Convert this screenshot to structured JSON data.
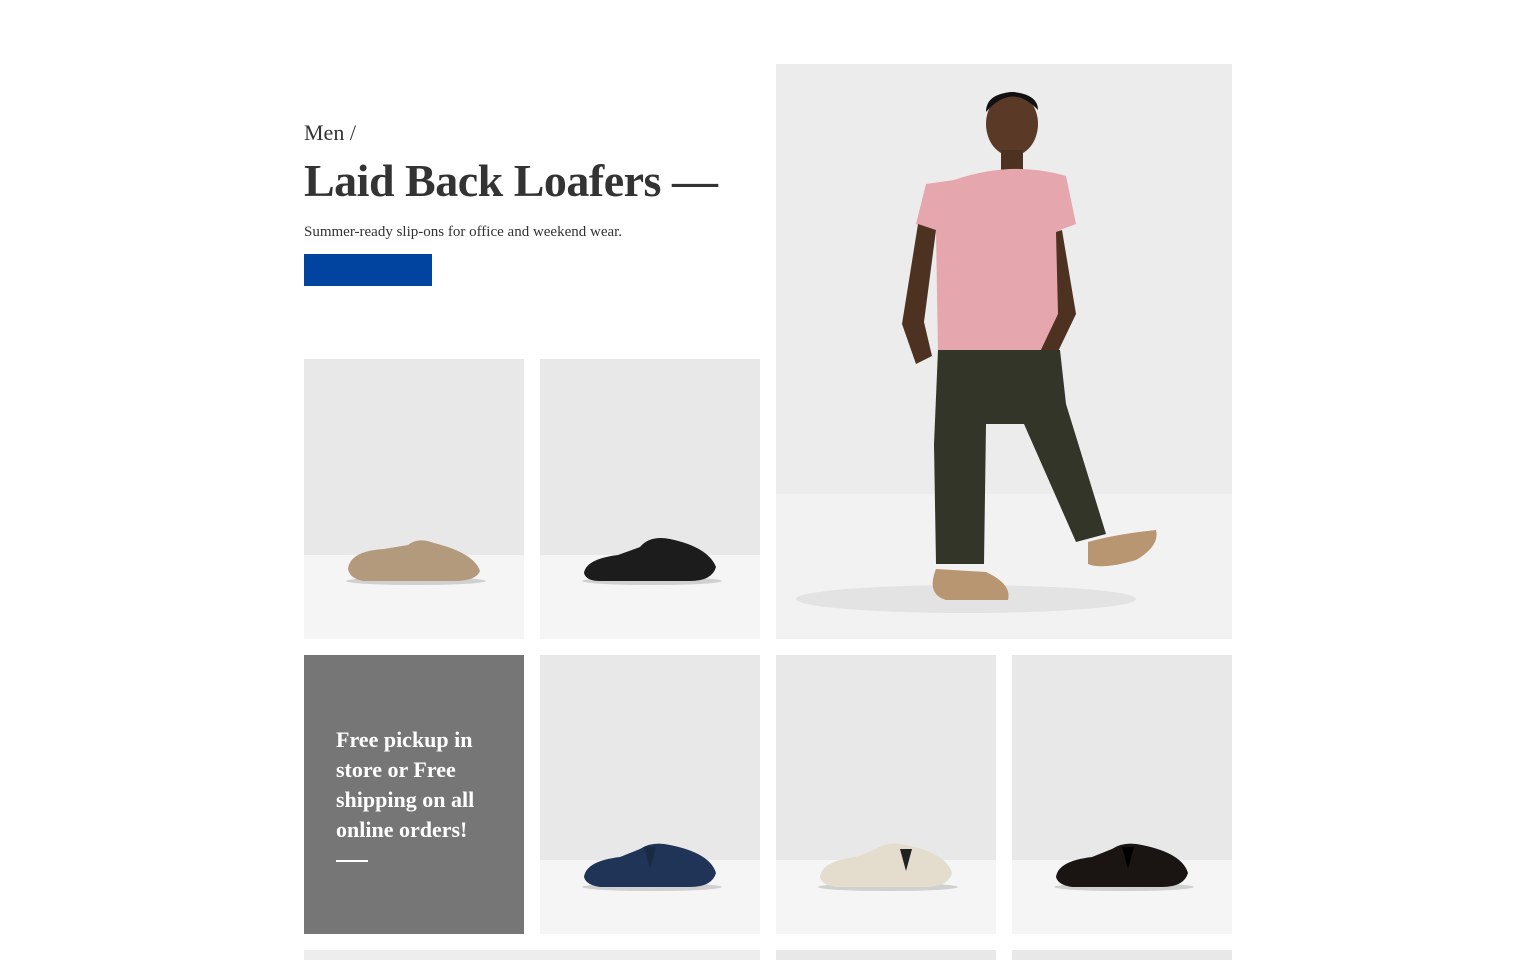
{
  "hero": {
    "breadcrumb": "Men /",
    "title": "Laid Back Loafers —",
    "subtitle": "Summer-ready slip-ons for office and weekend wear.",
    "shop_button_label": ""
  },
  "promo": {
    "text": "Free pickup in store or Free shipping on all online orders!"
  },
  "products": [
    {
      "name": "tan suede mule loafer",
      "color": "#b39a7c"
    },
    {
      "name": "black leather mule loafer",
      "color": "#1c1c1c"
    },
    {
      "name": "navy suede tassel loafer",
      "color": "#1f3456"
    },
    {
      "name": "cream suede tassel loafer",
      "color": "#e4dccd"
    },
    {
      "name": "black suede tassel loafer",
      "color": "#1a1412"
    }
  ],
  "lifestyle": {
    "name": "model walking in loafers"
  },
  "colors": {
    "accent": "#0044a0",
    "promo_bg": "#767676",
    "text": "#333333"
  }
}
